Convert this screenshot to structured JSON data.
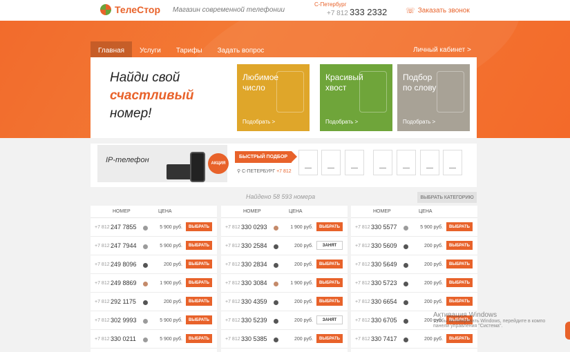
{
  "header": {
    "logo_text": "ТелеСтор",
    "tagline": "Магазин современной телефонии",
    "city": "С-Петербург",
    "phone_code": "+7 812",
    "phone_number": "333 2332",
    "callback_label": "Заказать звонок"
  },
  "nav": {
    "items": [
      "Главная",
      "Услуги",
      "Тарифы",
      "Задать вопрос"
    ],
    "cabinet": "Личный кабинет >"
  },
  "hero": {
    "line1": "Найди свой",
    "line2": "счастливый",
    "line3": "номер!",
    "tiles": [
      {
        "title1": "Любимое",
        "title2": "число",
        "link": "Подобрать >",
        "color": "#dfa62a"
      },
      {
        "title1": "Красивый",
        "title2": "хвост",
        "link": "Подобрать >",
        "color": "#6fa53a"
      },
      {
        "title1": "Подбор",
        "title2": "по слову",
        "link": "Подобрать >",
        "color": "#a8a296"
      }
    ]
  },
  "promo": {
    "ip_title": "IP-телефон",
    "badge": "АКЦИЯ",
    "quick_label": "БЫСТРЫЙ ПОДБОР",
    "city": "С-ПЕТЕРБУРГ",
    "code": "+7 812"
  },
  "found_text": "Найдено 58 593 номера",
  "category_button": "ВЫБРАТЬ КАТЕГОРИЮ",
  "table_headers": {
    "number": "НОМЕР",
    "price": "ЦЕНА"
  },
  "tables": [
    {
      "rows": [
        {
          "code": "+7 812",
          "number": "247 7855",
          "dot": "gray",
          "price": "5 900 руб.",
          "button": "ВЫБРАТЬ"
        },
        {
          "code": "+7 812",
          "number": "247 7944",
          "dot": "gray",
          "price": "5 900 руб.",
          "button": "ВЫБРАТЬ"
        },
        {
          "code": "+7 812",
          "number": "249 8096",
          "dot": "dark",
          "price": "200 руб.",
          "button": "ВЫБРАТЬ"
        },
        {
          "code": "+7 812",
          "number": "249 8869",
          "dot": "tan",
          "price": "1 900 руб.",
          "button": "ВЫБРАТЬ"
        },
        {
          "code": "+7 812",
          "number": "292 1175",
          "dot": "dark",
          "price": "200 руб.",
          "button": "ВЫБРАТЬ"
        },
        {
          "code": "+7 812",
          "number": "302 9993",
          "dot": "gray",
          "price": "5 900 руб.",
          "button": "ВЫБРАТЬ"
        },
        {
          "code": "+7 812",
          "number": "330 0211",
          "dot": "gray",
          "price": "5 900 руб.",
          "button": "ВЫБРАТЬ"
        }
      ]
    },
    {
      "rows": [
        {
          "code": "+7 812",
          "number": "330 0293",
          "dot": "tan",
          "price": "1 900 руб.",
          "button": "ВЫБРАТЬ"
        },
        {
          "code": "+7 812",
          "number": "330 2584",
          "dot": "dark",
          "price": "200 руб.",
          "button": "ЗАНЯТ"
        },
        {
          "code": "+7 812",
          "number": "330 2834",
          "dot": "dark",
          "price": "200 руб.",
          "button": "ВЫБРАТЬ"
        },
        {
          "code": "+7 812",
          "number": "330 3084",
          "dot": "tan",
          "price": "1 900 руб.",
          "button": "ВЫБРАТЬ"
        },
        {
          "code": "+7 812",
          "number": "330 4359",
          "dot": "dark",
          "price": "200 руб.",
          "button": "ВЫБРАТЬ"
        },
        {
          "code": "+7 812",
          "number": "330 5239",
          "dot": "dark",
          "price": "200 руб.",
          "button": "ЗАНЯТ"
        },
        {
          "code": "+7 812",
          "number": "330 5385",
          "dot": "dark",
          "price": "200 руб.",
          "button": "ВЫБРАТЬ"
        }
      ]
    },
    {
      "rows": [
        {
          "code": "+7 812",
          "number": "330 5577",
          "dot": "gray",
          "price": "5 900 руб.",
          "button": "ВЫБРАТЬ"
        },
        {
          "code": "+7 812",
          "number": "330 5609",
          "dot": "dark",
          "price": "200 руб.",
          "button": "ВЫБРАТЬ"
        },
        {
          "code": "+7 812",
          "number": "330 5649",
          "dot": "dark",
          "price": "200 руб.",
          "button": "ВЫБРАТЬ"
        },
        {
          "code": "+7 812",
          "number": "330 5723",
          "dot": "dark",
          "price": "200 руб.",
          "button": "ВЫБРАТЬ"
        },
        {
          "code": "+7 812",
          "number": "330 6654",
          "dot": "dark",
          "price": "200 руб.",
          "button": "ВЫБРАТЬ"
        },
        {
          "code": "+7 812",
          "number": "330 6705",
          "dot": "dark",
          "price": "200 руб.",
          "button": "ВЫБРАТЬ"
        },
        {
          "code": "+7 812",
          "number": "330 7417",
          "dot": "dark",
          "price": "200 руб.",
          "button": "ВЫБРАТЬ"
        }
      ]
    }
  ],
  "watermark": {
    "line1": "Активация Windows",
    "line2": "Чтобы активировать Windows, перейдите в компо",
    "line3": "панели управления \"Система\"."
  },
  "colors": {
    "accent": "#e8622a",
    "green": "#6fa53a",
    "yellow": "#dfa62a",
    "gray": "#a8a296"
  }
}
